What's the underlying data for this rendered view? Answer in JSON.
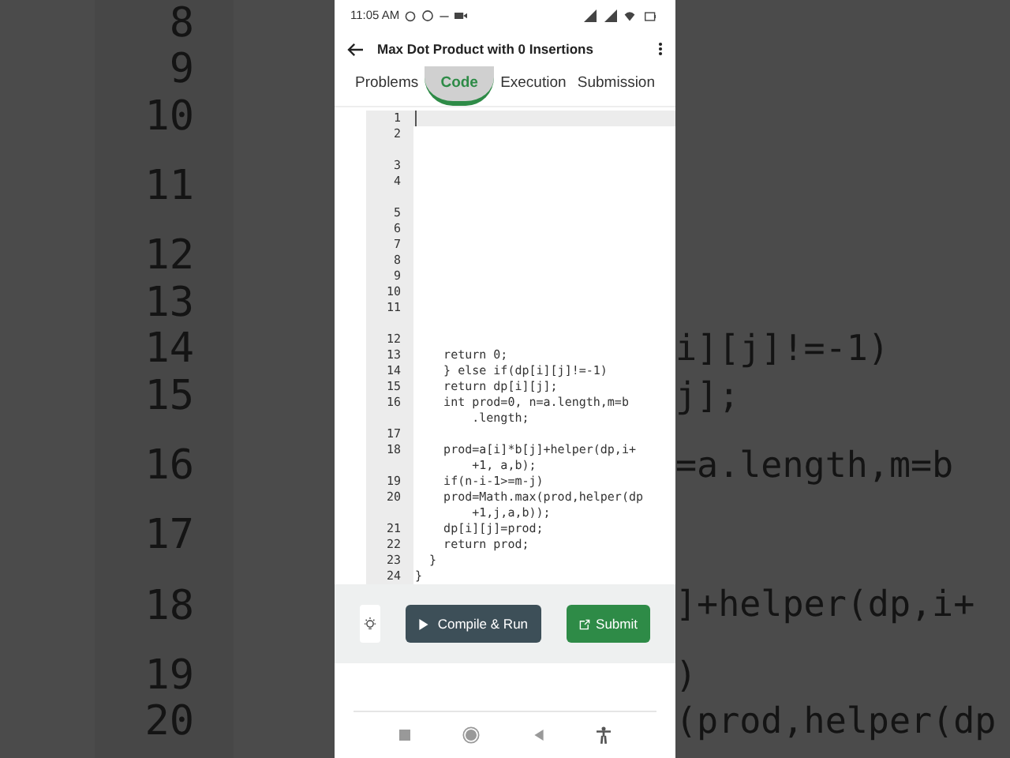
{
  "backdrop": {
    "rows": [
      {
        "num": "8",
        "tall": false
      },
      {
        "num": "9",
        "tall": false
      },
      {
        "num": "10",
        "tall": false
      },
      {
        "num": "11",
        "tall": true
      },
      {
        "num": "12",
        "tall": false
      },
      {
        "num": "13",
        "tall": false
      },
      {
        "num": "14",
        "tall": false,
        "code": "i][j]!=-1)"
      },
      {
        "num": "15",
        "tall": false,
        "code": "j];"
      },
      {
        "num": "16",
        "tall": true,
        "code": "=a.length,m=b"
      },
      {
        "num": "17",
        "tall": false
      },
      {
        "num": "18",
        "tall": true,
        "code": "]+helper(dp,i+"
      },
      {
        "num": "19",
        "tall": false,
        "code": ")"
      },
      {
        "num": "20",
        "tall": false,
        "code": "(prod,helper(dp"
      }
    ]
  },
  "status_bar": {
    "time": "11:05 AM"
  },
  "header": {
    "title": "Max Dot Product with 0 Insertions"
  },
  "tabs": [
    {
      "label": "Problems",
      "selected": false,
      "pressed": false
    },
    {
      "label": "Code",
      "selected": true,
      "pressed": true
    },
    {
      "label": "Execution",
      "selected": false,
      "pressed": false
    },
    {
      "label": "Submission",
      "selected": false,
      "pressed": false
    }
  ],
  "editor": {
    "lines": [
      {
        "num": "1",
        "current": true,
        "tall": false
      },
      {
        "num": "2",
        "current": false,
        "tall": true
      },
      {
        "num": "3",
        "current": false,
        "tall": false
      },
      {
        "num": "4",
        "current": false,
        "tall": true
      },
      {
        "num": "5",
        "current": false,
        "tall": false
      },
      {
        "num": "6",
        "current": false,
        "tall": false
      },
      {
        "num": "7",
        "current": false,
        "tall": false
      },
      {
        "num": "8",
        "current": false,
        "tall": false
      },
      {
        "num": "9",
        "current": false,
        "tall": false
      },
      {
        "num": "10",
        "current": false,
        "tall": false
      },
      {
        "num": "11",
        "current": false,
        "tall": true
      },
      {
        "num": "12",
        "current": false,
        "tall": false
      },
      {
        "num": "13",
        "current": false,
        "tall": false,
        "text": "    return 0;"
      },
      {
        "num": "14",
        "current": false,
        "tall": false,
        "text": "    } else if(dp[i][j]!=-1)"
      },
      {
        "num": "15",
        "current": false,
        "tall": false,
        "text": "    return dp[i][j];"
      },
      {
        "num": "16",
        "current": false,
        "text": "    int prod=0, n=a.length,m=b",
        "cont": "        .length;"
      },
      {
        "num": "17",
        "current": false,
        "tall": false
      },
      {
        "num": "18",
        "current": false,
        "text": "    prod=a[i]*b[j]+helper(dp,i+",
        "cont": "        +1, a,b);"
      },
      {
        "num": "19",
        "current": false,
        "tall": false,
        "text": "    if(n-i-1>=m-j)"
      },
      {
        "num": "20",
        "current": false,
        "text": "    prod=Math.max(prod,helper(dp",
        "cont": "        +1,j,a,b));"
      },
      {
        "num": "21",
        "current": false,
        "tall": false,
        "text": "    dp[i][j]=prod;"
      },
      {
        "num": "22",
        "current": false,
        "tall": false,
        "text": "    return prod;"
      },
      {
        "num": "23",
        "current": false,
        "tall": false,
        "text": "  }"
      },
      {
        "num": "24",
        "current": false,
        "tall": false,
        "text": "}"
      }
    ]
  },
  "actions": {
    "run": "Compile & Run",
    "submit": "Submit"
  }
}
